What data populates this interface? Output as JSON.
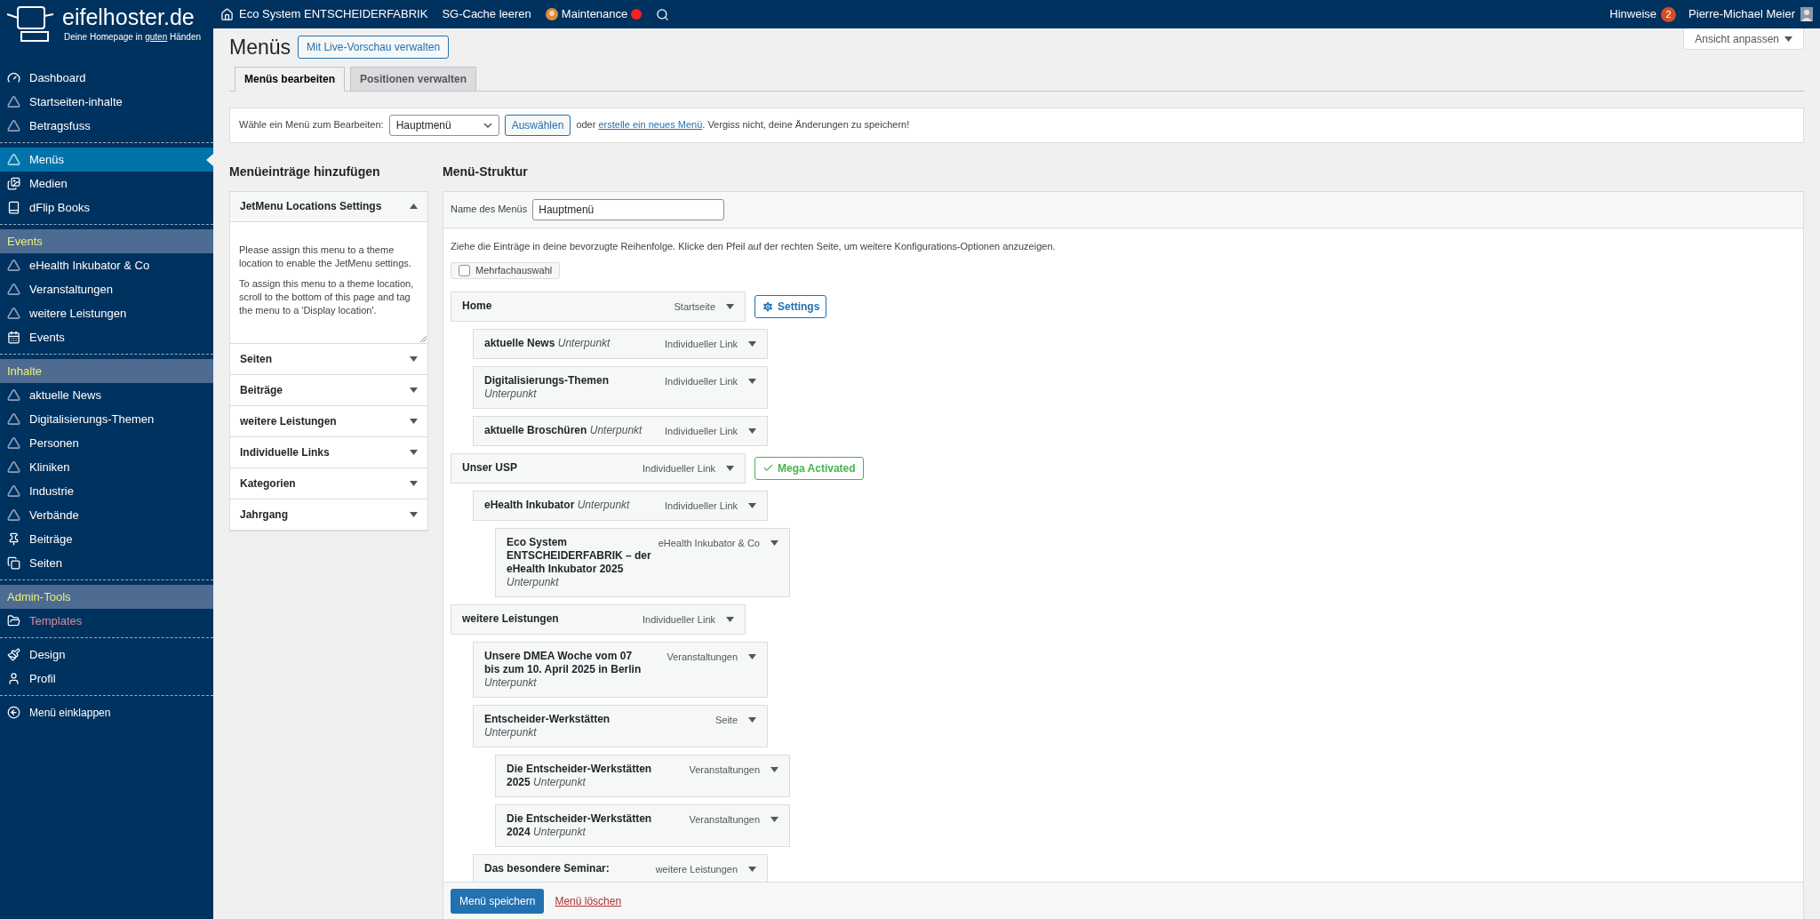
{
  "logo": {
    "name": "eifelhoster.de",
    "tagline_before": "Deine Homepage in",
    "tagline_underlined": "guten",
    "tagline_after": "Händen"
  },
  "sidebar": {
    "groups": [
      {
        "items": [
          {
            "label": "Dashboard",
            "selected": false
          },
          {
            "label": "Startseiten-inhalte",
            "selected": false
          },
          {
            "label": "Betragsfuss",
            "selected": false
          }
        ]
      },
      {
        "items": [
          {
            "label": "Menüs",
            "selected": true
          },
          {
            "label": "Medien",
            "selected": false
          },
          {
            "label": "dFlip Books",
            "selected": false
          }
        ]
      },
      {
        "heading": "Events",
        "items": [
          {
            "label": "eHealth Inkubator & Co",
            "selected": false
          },
          {
            "label": "Veranstaltungen",
            "selected": false
          },
          {
            "label": "weitere Leistungen",
            "selected": false
          },
          {
            "label": "Events",
            "selected": false
          }
        ]
      },
      {
        "heading": "Inhalte",
        "items": [
          {
            "label": "aktuelle News",
            "selected": false
          },
          {
            "label": "Digitalisierungs-Themen",
            "selected": false
          },
          {
            "label": "Personen",
            "selected": false
          },
          {
            "label": "Kliniken",
            "selected": false
          },
          {
            "label": "Industrie",
            "selected": false
          },
          {
            "label": "Verbände",
            "selected": false
          },
          {
            "label": "Beiträge",
            "selected": false
          },
          {
            "label": "Seiten",
            "selected": false
          }
        ]
      },
      {
        "heading": "Admin-Tools",
        "items": [
          {
            "label": "Templates",
            "selected": false,
            "color": "#d98b93"
          }
        ]
      },
      {
        "items": [
          {
            "label": "Design",
            "selected": false
          },
          {
            "label": "Profil",
            "selected": false
          }
        ]
      }
    ],
    "collapse_label": "Menü einklappen"
  },
  "admin_bar": {
    "site": "Eco System ENTSCHEIDERFABRIK",
    "cache": "SG-Cache leeren",
    "maintenance": "Maintenance",
    "notices": "Hinweise",
    "notices_count": "2",
    "user": "Pierre-Michael Meier"
  },
  "page": {
    "title": "Menüs",
    "live_preview_button": "Mit Live-Vorschau verwalten",
    "screen_options": "Ansicht anpassen",
    "tabs": [
      {
        "label": "Menüs bearbeiten",
        "selected": true
      },
      {
        "label": "Positionen verwalten",
        "selected": false
      }
    ],
    "select_row": {
      "label": "Wähle ein Menü zum Bearbeiten:",
      "value": "Hauptmenü",
      "button": "Auswählen",
      "text_before": "oder",
      "link": "erstelle ein neues Menü",
      "text_after": ". Vergiss nicht, deine Änderungen zu speichern!"
    }
  },
  "add_items": {
    "heading": "Menüeinträge hinzufügen",
    "sections": [
      {
        "title": "JetMenu Locations Settings",
        "expanded": true,
        "paragraphs": [
          "Please assign this menu to a theme location to enable the JetMenu settings.",
          "To assign this menu to a theme location, scroll to the bottom of this page and tag the menu to a 'Display location'."
        ]
      },
      {
        "title": "Seiten",
        "expanded": false
      },
      {
        "title": "Beiträge",
        "expanded": false
      },
      {
        "title": "weitere Leistungen",
        "expanded": false
      },
      {
        "title": "Individuelle Links",
        "expanded": false
      },
      {
        "title": "Kategorien",
        "expanded": false
      },
      {
        "title": "Jahrgang",
        "expanded": false
      }
    ]
  },
  "structure": {
    "heading": "Menü-Struktur",
    "name_label": "Name des Menüs",
    "name_value": "Hauptmenü",
    "instructions": "Ziehe die Einträge in deine bevorzugte Reihenfolge. Klicke den Pfeil auf der rechten Seite, um weitere Konfigurations-Optionen anzuzeigen.",
    "bulk_select": {
      "label": "Mehrfachauswahl",
      "checked": false
    },
    "items": [
      {
        "title": "Home",
        "type": "Startseite",
        "badge": {
          "kind": "settings",
          "label": "Settings"
        },
        "children": [
          {
            "title": "aktuelle News",
            "subtitle": "Unterpunkt",
            "type": "Individueller Link"
          },
          {
            "title": "Digitalisierungs-Themen",
            "subtitle": "Unterpunkt",
            "type": "Individueller Link"
          },
          {
            "title": "aktuelle Broschüren",
            "subtitle": "Unterpunkt",
            "type": "Individueller Link"
          }
        ]
      },
      {
        "title": "Unser USP",
        "type": "Individueller Link",
        "badge": {
          "kind": "mega",
          "label": "Mega Activated"
        },
        "children": [
          {
            "title": "eHealth Inkubator",
            "subtitle": "Unterpunkt",
            "type": "Individueller Link",
            "children": [
              {
                "title": "Eco System ENTSCHEIDERFABRIK – der eHealth Inkubator 2025",
                "subtitle": "Unterpunkt",
                "type": "eHealth Inkubator & Co"
              }
            ]
          }
        ]
      },
      {
        "title": "weitere Leistungen",
        "type": "Individueller Link",
        "children": [
          {
            "title": "Unsere DMEA Woche vom 07 bis zum 10. April 2025 in Berlin",
            "subtitle": "Unterpunkt",
            "type": "Veranstaltungen"
          },
          {
            "title": "Entscheider-Werkstätten",
            "subtitle": "Unterpunkt",
            "type": "Seite",
            "children": [
              {
                "title": "Die Entscheider-Werkstätten 2025",
                "subtitle": "Unterpunkt",
                "type": "Veranstaltungen"
              },
              {
                "title": "Die Entscheider-Werkstätten 2024",
                "subtitle": "Unterpunkt",
                "type": "Veranstaltungen"
              }
            ]
          },
          {
            "title": "Das besondere Seminar:",
            "type": "weitere Leistungen"
          }
        ]
      }
    ],
    "save_button": "Menü speichern",
    "delete_link": "Menü löschen"
  }
}
